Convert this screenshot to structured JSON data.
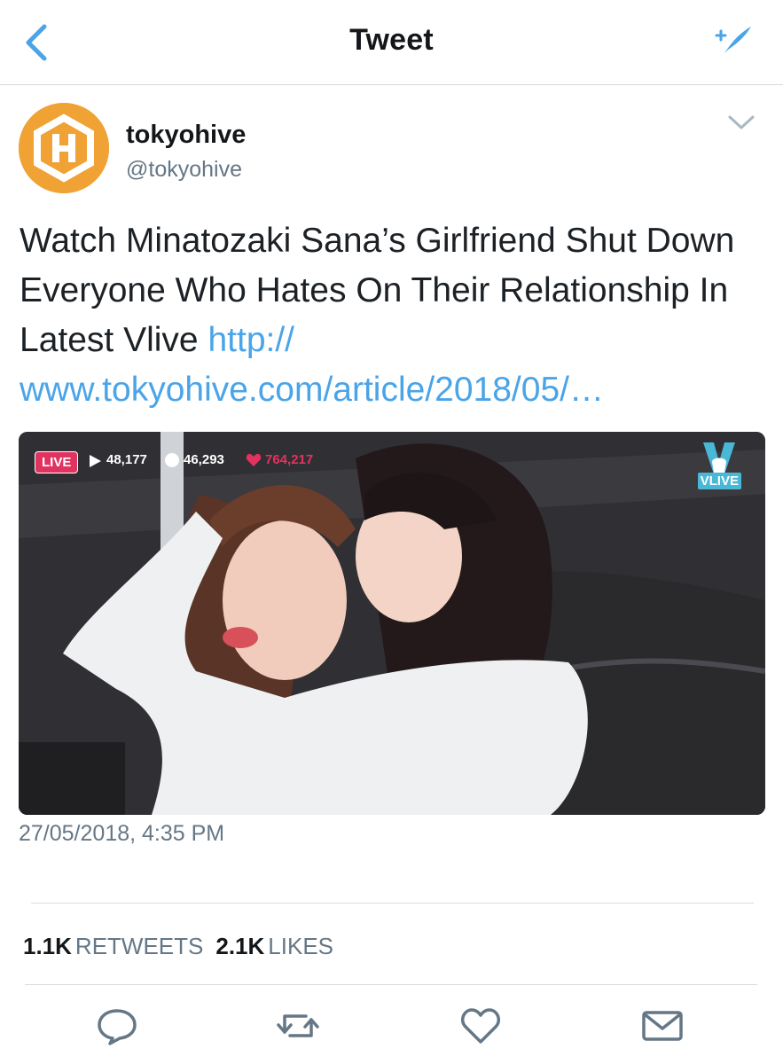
{
  "nav": {
    "title": "Tweet",
    "back_icon": "back-chevron-icon",
    "compose_icon": "compose-tweet-icon",
    "accent_color": "#4aa4e8"
  },
  "author": {
    "name": "tokyohive",
    "handle": "@tokyohive",
    "avatar_color": "#f0a234"
  },
  "tweet": {
    "text": "Watch Minatozaki Sana’s Girlfriend Shut Down Everyone Who Hates On Their Relationship In Latest Vlive ",
    "link_line1": "http://",
    "link_line2": "www.tokyohive.com/article/2018/05/…",
    "timestamp": "27/05/2018, 4:35 PM"
  },
  "media": {
    "live_label": "LIVE",
    "views": "48,177",
    "comments": "46,293",
    "hearts": "764,217",
    "logo_text": "VLIVE"
  },
  "stats": {
    "retweets_count": "1.1K",
    "retweets_label": "RETWEETS",
    "likes_count": "2.1K",
    "likes_label": "LIKES"
  },
  "actions": [
    "reply-icon",
    "retweet-icon",
    "like-icon",
    "share-icon"
  ]
}
